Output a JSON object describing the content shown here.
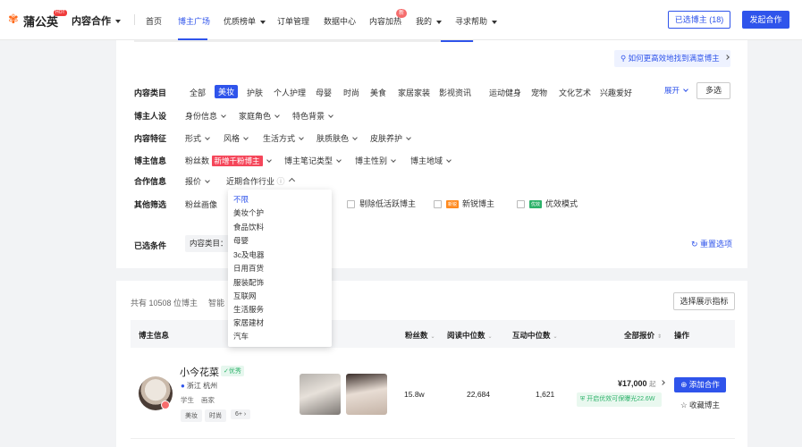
{
  "nav": {
    "logo_text": "蒲公英",
    "logo_badge": "HOT",
    "brand_sub": "内容合作",
    "items": [
      {
        "label": "首页"
      },
      {
        "label": "博主广场"
      },
      {
        "label": "优质榜单"
      },
      {
        "label": "订单管理"
      },
      {
        "label": "数据中心"
      },
      {
        "label": "内容加热"
      },
      {
        "label": "我的"
      },
      {
        "label": "寻求帮助"
      }
    ],
    "new_badge": "新",
    "selected_btn": "已选博主 (18)",
    "start_btn": "发起合作",
    "accent": "#2f54eb"
  },
  "filters": {
    "tip": "如何更高效地找到满意博主",
    "category_label": "内容类目",
    "categories": [
      "全部",
      "美妆",
      "护肤",
      "个人护理",
      "母婴",
      "时尚",
      "美食",
      "家居家装",
      "影视资讯",
      "运动健身",
      "宠物",
      "文化艺术",
      "兴趣爱好"
    ],
    "selected_category": "美妆",
    "expand": "展开",
    "multi": "多选",
    "persona_label": "博主人设",
    "persona": [
      "身份信息",
      "家庭角色",
      "特色背景"
    ],
    "content_label": "内容特征",
    "content": [
      "形式",
      "风格",
      "生活方式",
      "肤质肤色",
      "皮肤养护"
    ],
    "info_label": "博主信息",
    "fans": "粉丝数",
    "fans_badge": "新增千粉博主",
    "info": [
      "博主笔记类型",
      "博主性别",
      "博主地域"
    ],
    "coop_label": "合作信息",
    "coop": [
      "报价",
      "近期合作行业"
    ],
    "other_label": "其他筛选",
    "fan_portrait": "粉丝画像",
    "remove_inactive": "剔除低活跃博主",
    "new_badge_small": "新锐",
    "new_blogger": "新锐博主",
    "quality_badge_small": "优效",
    "quality_mode": "优效模式",
    "chosen_label": "已选条件",
    "chosen_chip": "内容类目：",
    "reset": "重置选项"
  },
  "dropdown": {
    "items": [
      "不限",
      "美妆个护",
      "食品饮料",
      "母婴",
      "3c及电器",
      "日用百货",
      "服装配饰",
      "互联网",
      "生活服务",
      "家居建材",
      "汽车"
    ]
  },
  "results": {
    "count": "共有 10508 位博主",
    "count_tail": "智能",
    "select_metrics": "选择展示指标",
    "headers": {
      "info": "博主信息",
      "fans": "粉丝数",
      "read": "阅读中位数",
      "interact": "互动中位数",
      "price": "全部报价",
      "action": "操作"
    },
    "row": {
      "name": "小今花菜",
      "verified": "优秀",
      "location": "浙江 杭州",
      "roles": [
        "学生",
        "画家"
      ],
      "tags": [
        "美妆",
        "时尚",
        "6+"
      ],
      "fans": "15.8w",
      "read": "22,684",
      "interact": "1,621",
      "price": "¥17,000",
      "price_suffix": "起",
      "boost": "开启优效可保曝光22.6W",
      "add": "添加合作",
      "fav": "收藏博主"
    }
  }
}
